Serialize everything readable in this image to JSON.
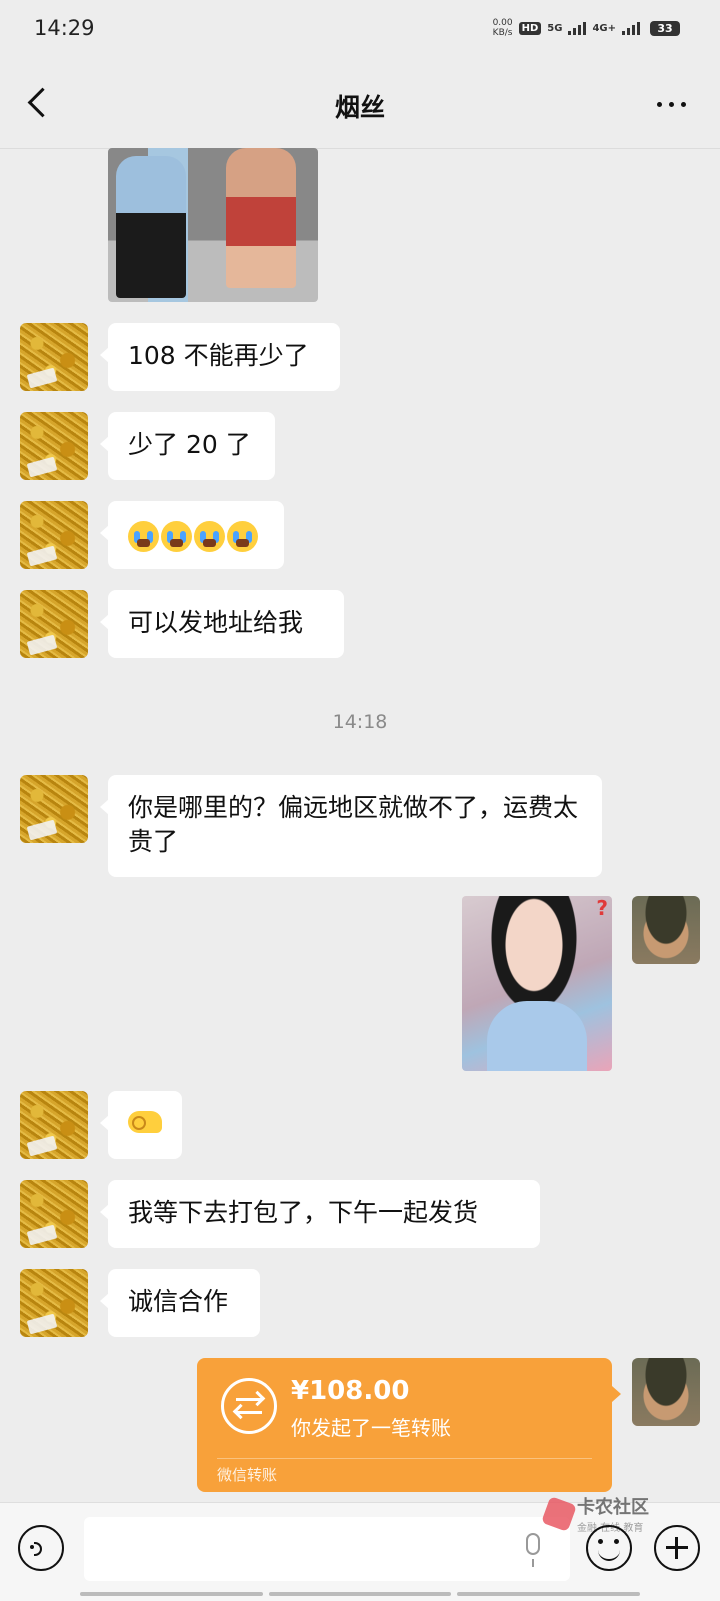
{
  "status_bar": {
    "time": "14:29",
    "net_speed_value": "0.00",
    "net_speed_unit": "KB/s",
    "hd_label": "HD",
    "signal_1": "5G",
    "signal_2": "4G+",
    "battery": "33"
  },
  "header": {
    "title": "烟丝"
  },
  "messages": [
    {
      "type": "text",
      "sender": "other",
      "text": "108 不能再少了"
    },
    {
      "type": "text",
      "sender": "other",
      "text": "少了 20 了"
    },
    {
      "type": "emoji",
      "sender": "other",
      "emoji": "loudly-crying-face x4"
    },
    {
      "type": "text",
      "sender": "other",
      "text": "可以发地址给我"
    },
    {
      "type": "text",
      "sender": "other",
      "text": "你是哪里的？偏远地区就做不了，运费太贵了"
    },
    {
      "type": "emoji",
      "sender": "other",
      "emoji": "strong-arm"
    },
    {
      "type": "text",
      "sender": "other",
      "text": "我等下去打包了，下午一起发货"
    },
    {
      "type": "text",
      "sender": "other",
      "text": "诚信合作"
    }
  ],
  "timestamp": "14:18",
  "sticker_mark": "?",
  "transfer": {
    "amount": "¥108.00",
    "description": "你发起了一笔转账",
    "footer": "微信转账"
  },
  "watermark": {
    "title": "卡农社区",
    "subtitle": "金融 在线 教育"
  },
  "input_bar": {
    "placeholder": ""
  }
}
